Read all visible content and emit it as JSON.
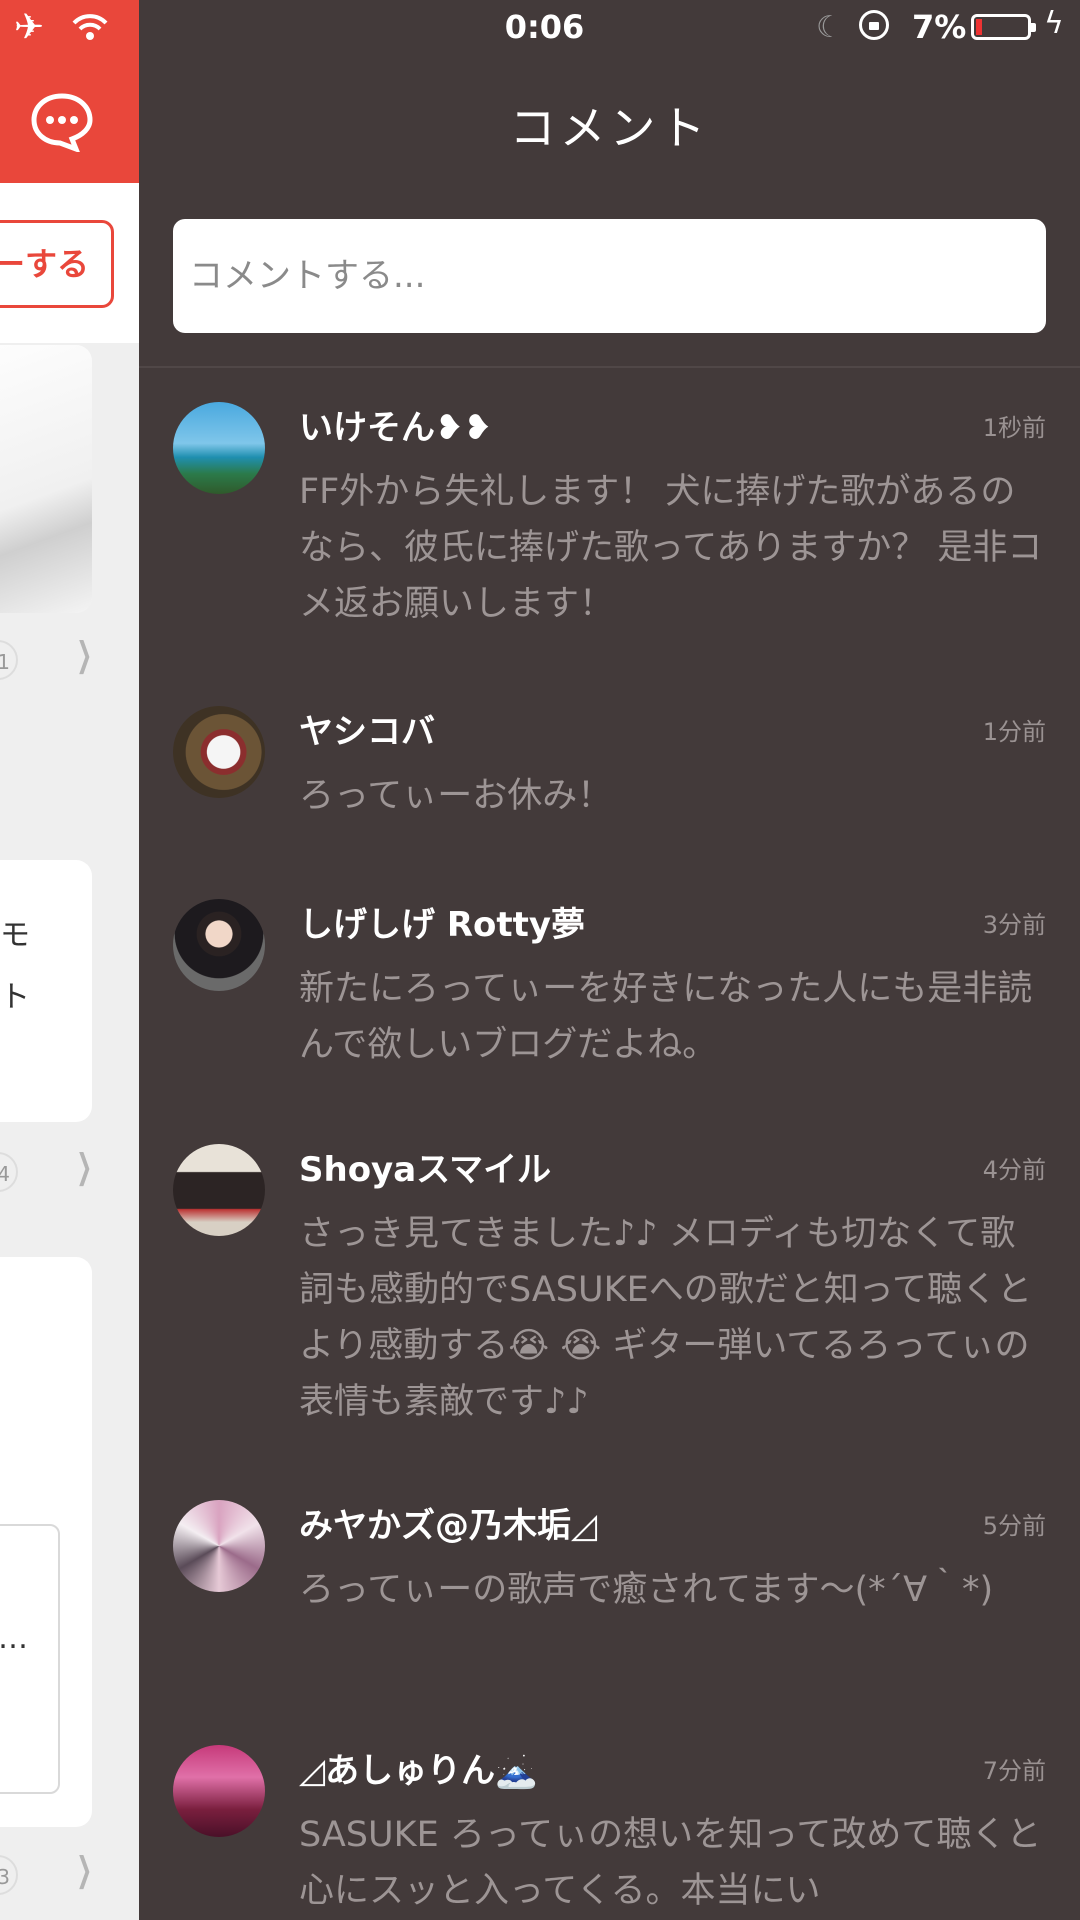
{
  "background_app": {
    "follow_label": "ーする",
    "counts": [
      "1",
      "4",
      "3"
    ],
    "text_fragments": [
      "モ",
      "ト",
      "…"
    ],
    "accent_color": "#e9473b",
    "icons": [
      "airplane-icon",
      "wifi-icon",
      "chat-bubble-icon",
      "chevron-right-icon"
    ]
  },
  "status_bar": {
    "time": "0:06",
    "battery": "7%",
    "icons": [
      "moon-icon",
      "rotation-lock-icon",
      "battery-icon",
      "charging-bolt-icon"
    ]
  },
  "panel": {
    "title": "コメント",
    "input_placeholder": "コメントする..."
  },
  "comments": [
    {
      "name": "いけそん❥❥",
      "time": "1秒前",
      "text": "FF外から失礼します！ 犬に捧げた歌があるのなら、彼氏に捧げた歌ってありますか？ 是非コメ返お願いします！"
    },
    {
      "name": "ヤシコバ",
      "time": "1分前",
      "text": "ろってぃーお休み！"
    },
    {
      "name": "しげしげ Rotty夢",
      "time": "3分前",
      "text": "新たにろってぃーを好きになった人にも是非読んで欲しいブログだよね。"
    },
    {
      "name": "Shoyaスマイル",
      "time": "4分前",
      "text": "さっき見てきました♪♪ メロディも切なくて歌詞も感動的でSASUKEへの歌だと知って聴くとより感動する😭 😭 ギター弾いてるろってぃの表情も素敵です♪♪"
    },
    {
      "name": "みヤかズ@乃木垢◿",
      "time": "5分前",
      "text": "ろってぃーの歌声で癒されてます〜(*´∀｀*)"
    },
    {
      "name": "◿あしゅりん🗻",
      "time": "7分前",
      "text": "SASUKE ろってぃの想いを知って改めて聴くと心にスッと入ってくる。本当にい"
    }
  ]
}
